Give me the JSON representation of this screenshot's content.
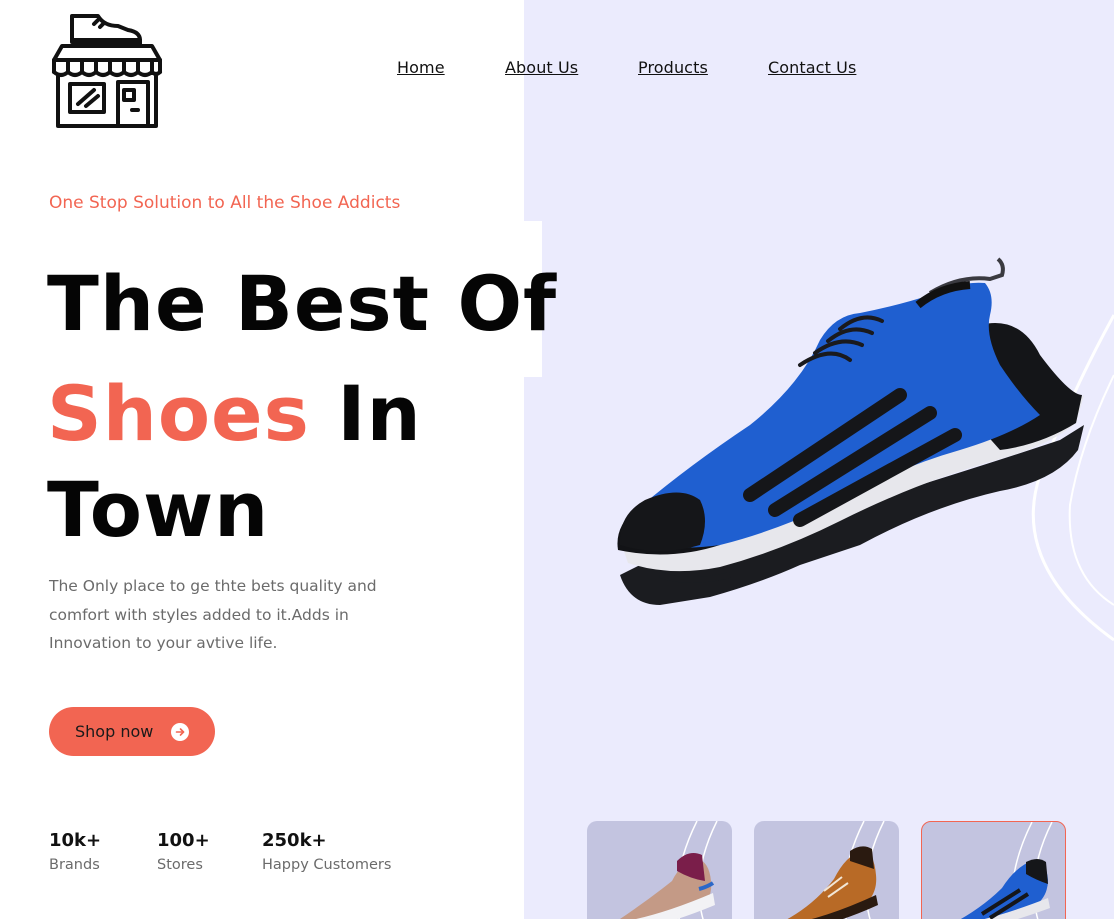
{
  "nav": {
    "items": [
      {
        "label": "Home"
      },
      {
        "label": "About Us"
      },
      {
        "label": "Products"
      },
      {
        "label": "Contact Us"
      }
    ]
  },
  "hero": {
    "tagline": "One Stop Solution to All the Shoe Addicts",
    "headline_line1": "The Best Of",
    "headline_accent": "Shoes",
    "headline_line2_rest": " In",
    "headline_line3": "Town",
    "description": "The Only place to ge thte bets quality and comfort with styles added to it.Adds in Innovation to your avtive life.",
    "cta_label": "Shop now"
  },
  "stats": [
    {
      "value": "10k+",
      "label": "Brands"
    },
    {
      "value": "100+",
      "label": "Stores"
    },
    {
      "value": "250k+",
      "label": "Happy Customers"
    }
  ],
  "icons": {
    "logo": "shoe-store-icon",
    "cta": "arrow-right-icon"
  },
  "colors": {
    "accent": "#f26552",
    "panel": "#ebebfd",
    "thumb_bg": "#c3c4e0",
    "text_dark": "#050505",
    "text_muted": "#6b6b6b"
  },
  "thumbnails": [
    {
      "selected": false
    },
    {
      "selected": false
    },
    {
      "selected": true
    }
  ]
}
